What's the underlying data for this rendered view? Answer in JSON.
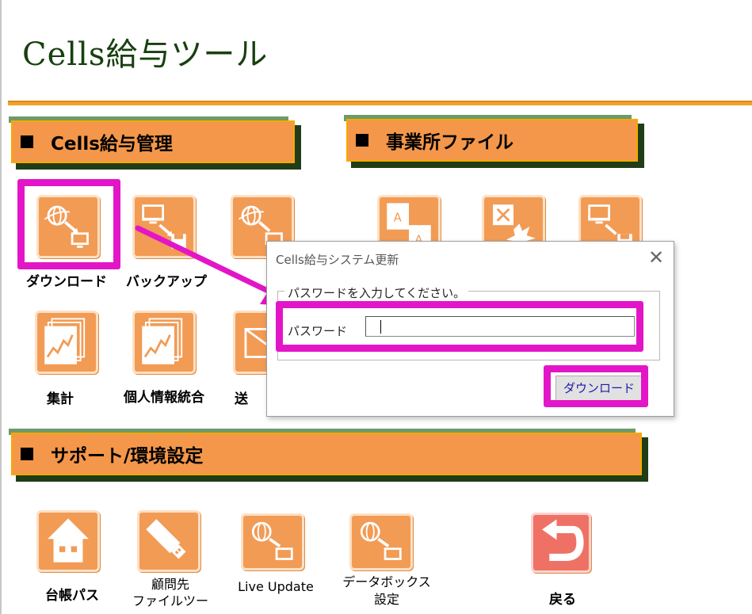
{
  "app": {
    "title": "Cells給与ツール"
  },
  "sections": {
    "payroll": {
      "title": "Cells給与管理"
    },
    "office": {
      "title": "事業所ファイル"
    },
    "support": {
      "title": "サポート/環境設定"
    }
  },
  "payroll_items": {
    "download": "ダウンロード",
    "backup": "バックアップ",
    "aggregate": "集計",
    "personal_merge": "個人情報統合",
    "send": "送"
  },
  "support_items": {
    "ledger_path": "台帳パス",
    "client_file_line1": "顧問先",
    "client_file_line2": "ファイルツー",
    "live_update": "Live Update",
    "databox_line1": "データボックス",
    "databox_line2": "設定",
    "back": "戻る"
  },
  "dialog": {
    "title": "Cells給与システム更新",
    "close_glyph": "✕",
    "group_label": "パスワードを入力してください。",
    "password_label": "パスワード",
    "password_value": "",
    "download_button": "ダウンロード"
  },
  "colors": {
    "tile_orange": "#f29b55",
    "header_orange": "#f4974a",
    "header_border": "#f7a800",
    "title_green": "#17400f",
    "highlight_magenta": "#e316c7"
  }
}
